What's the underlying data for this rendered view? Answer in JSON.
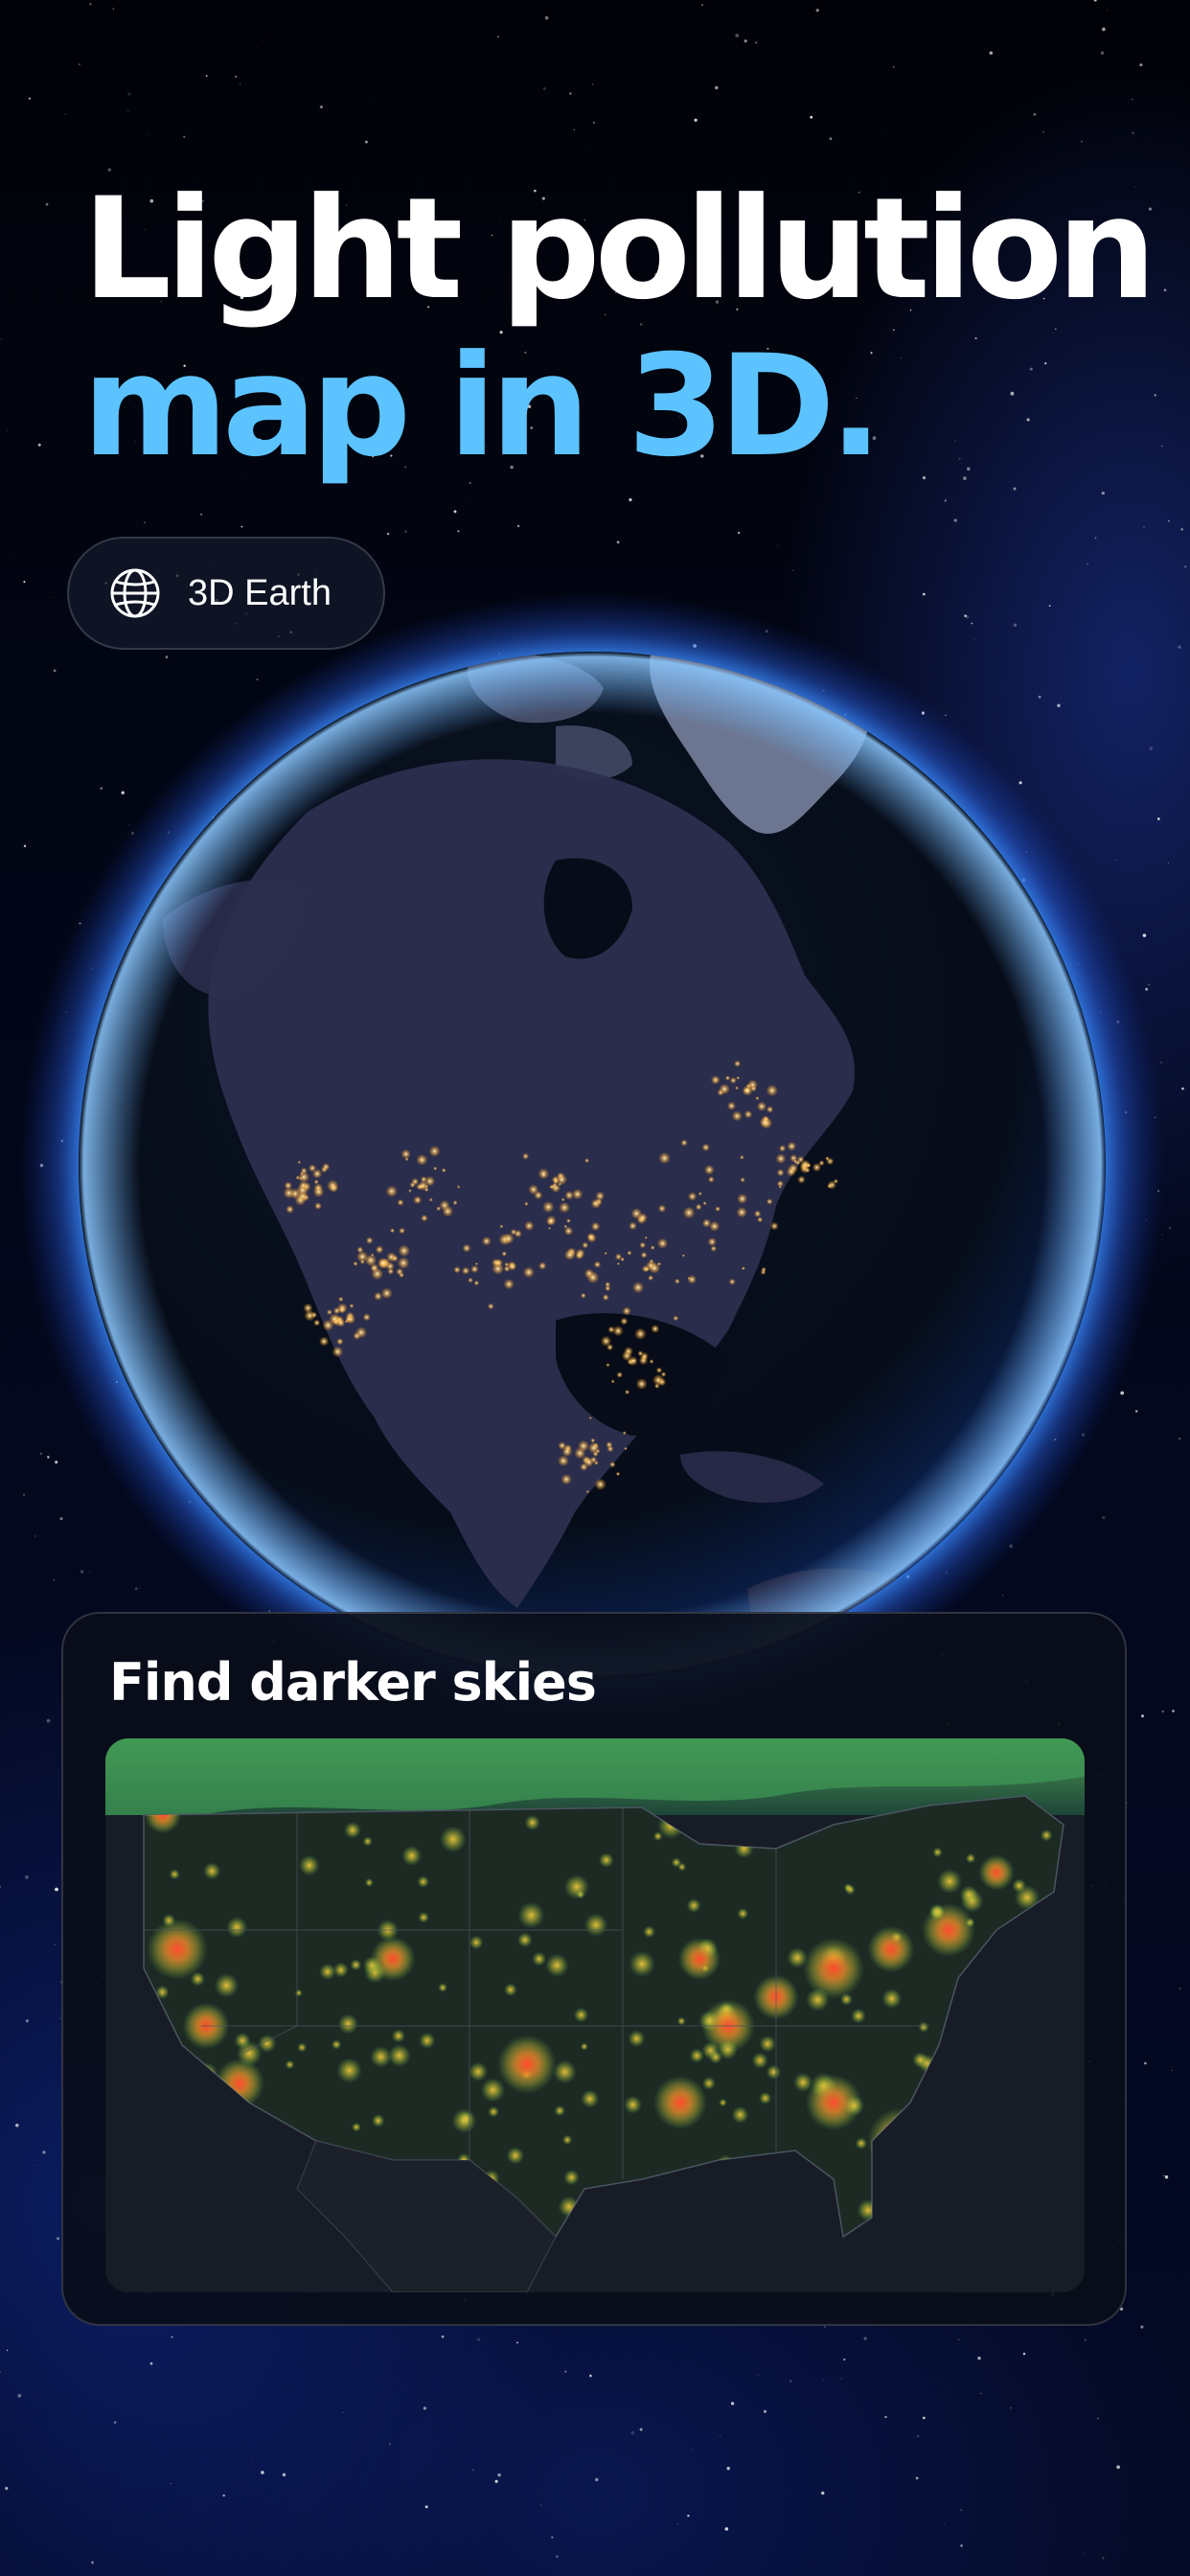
{
  "headline": {
    "line1": "Light pollution",
    "line2": "map in 3D."
  },
  "globe_pill": {
    "icon": "globe-icon",
    "label": "3D Earth"
  },
  "darker_skies_card": {
    "title": "Find darker skies"
  },
  "colors": {
    "accent_blue": "#5cc3ff",
    "headline_white": "#ffffff",
    "background": "#02040c",
    "card_background": "#0a0e1a",
    "city_lights": "#ffd98a",
    "pollution_low": "#3fb86b",
    "pollution_mid": "#e9d23c",
    "pollution_high": "#f0462e"
  }
}
